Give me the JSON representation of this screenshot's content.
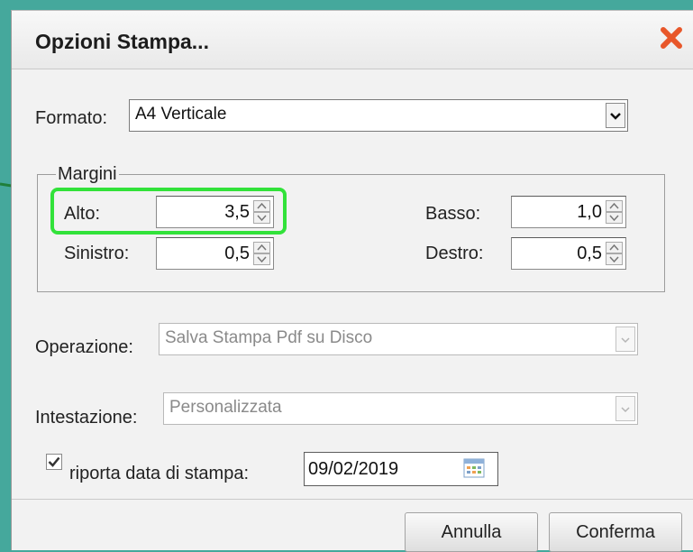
{
  "dialog": {
    "title": "Opzioni Stampa..."
  },
  "formato": {
    "label": "Formato:",
    "value": "A4 Verticale"
  },
  "margini": {
    "legend": "Margini",
    "alto": {
      "label": "Alto:",
      "value": "3,5"
    },
    "basso": {
      "label": "Basso:",
      "value": "1,0"
    },
    "sinistro": {
      "label": "Sinistro:",
      "value": "0,5"
    },
    "destro": {
      "label": "Destro:",
      "value": "0,5"
    }
  },
  "operazione": {
    "label": "Operazione:",
    "value": "Salva Stampa Pdf su Disco"
  },
  "intestazione": {
    "label": "Intestazione:",
    "value": "Personalizzata"
  },
  "data_stampa": {
    "label": "riporta data di stampa:",
    "value": "09/02/2019",
    "checked": true
  },
  "buttons": {
    "annulla": "Annulla",
    "conferma": "Conferma"
  },
  "colors": {
    "background": "#45a89c",
    "highlight": "#32e23a",
    "close": "#e8572a"
  },
  "icons": {
    "close": "close-icon",
    "calendar": "calendar-icon",
    "spinner": "spinner-arrows-icon",
    "dropdown": "chevron-down-icon"
  }
}
